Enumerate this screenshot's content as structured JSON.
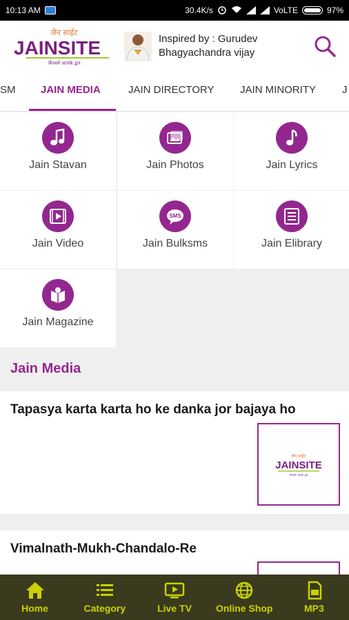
{
  "status_bar": {
    "time": "10:13 AM",
    "net_speed": "30.4K/s",
    "network": "VoLTE",
    "battery": "97%"
  },
  "header": {
    "logo_text": "JAINSITE",
    "logo_script": "जैन साईट",
    "logo_tagline": "जैनधर्म आपके द्वार",
    "inspired_line1": "Inspired by : Gurudev",
    "inspired_line2": "Bhagyachandra vijay"
  },
  "tabs": [
    {
      "label": "SM"
    },
    {
      "label": "JAIN MEDIA"
    },
    {
      "label": "JAIN DIRECTORY"
    },
    {
      "label": "JAIN MINORITY"
    },
    {
      "label": "J"
    }
  ],
  "grid": [
    {
      "label": "Jain Stavan",
      "icon": "music-note-icon"
    },
    {
      "label": "Jain Photos",
      "icon": "photos-icon"
    },
    {
      "label": "Jain Lyrics",
      "icon": "music-note-icon"
    },
    {
      "label": "Jain Video",
      "icon": "video-icon"
    },
    {
      "label": "Jain Bulksms",
      "icon": "sms-icon"
    },
    {
      "label": "Jain Elibrary",
      "icon": "list-icon"
    },
    {
      "label": "Jain Magazine",
      "icon": "magazine-icon"
    }
  ],
  "section_title": "Jain Media",
  "cards": [
    {
      "title": "Tapasya karta karta ho ke danka jor bajaya ho"
    },
    {
      "title": "Vimalnath-Mukh-Chandalo-Re"
    }
  ],
  "bottom_nav": [
    {
      "label": "Home",
      "icon": "home-icon"
    },
    {
      "label": "Category",
      "icon": "category-list-icon"
    },
    {
      "label": "Live TV",
      "icon": "tv-icon"
    },
    {
      "label": "Online Shop",
      "icon": "globe-icon"
    },
    {
      "label": "MP3",
      "icon": "mp3-icon"
    }
  ],
  "colors": {
    "accent": "#93278f",
    "nav_bg": "#3a3a1e",
    "nav_fg": "#c9d300"
  }
}
